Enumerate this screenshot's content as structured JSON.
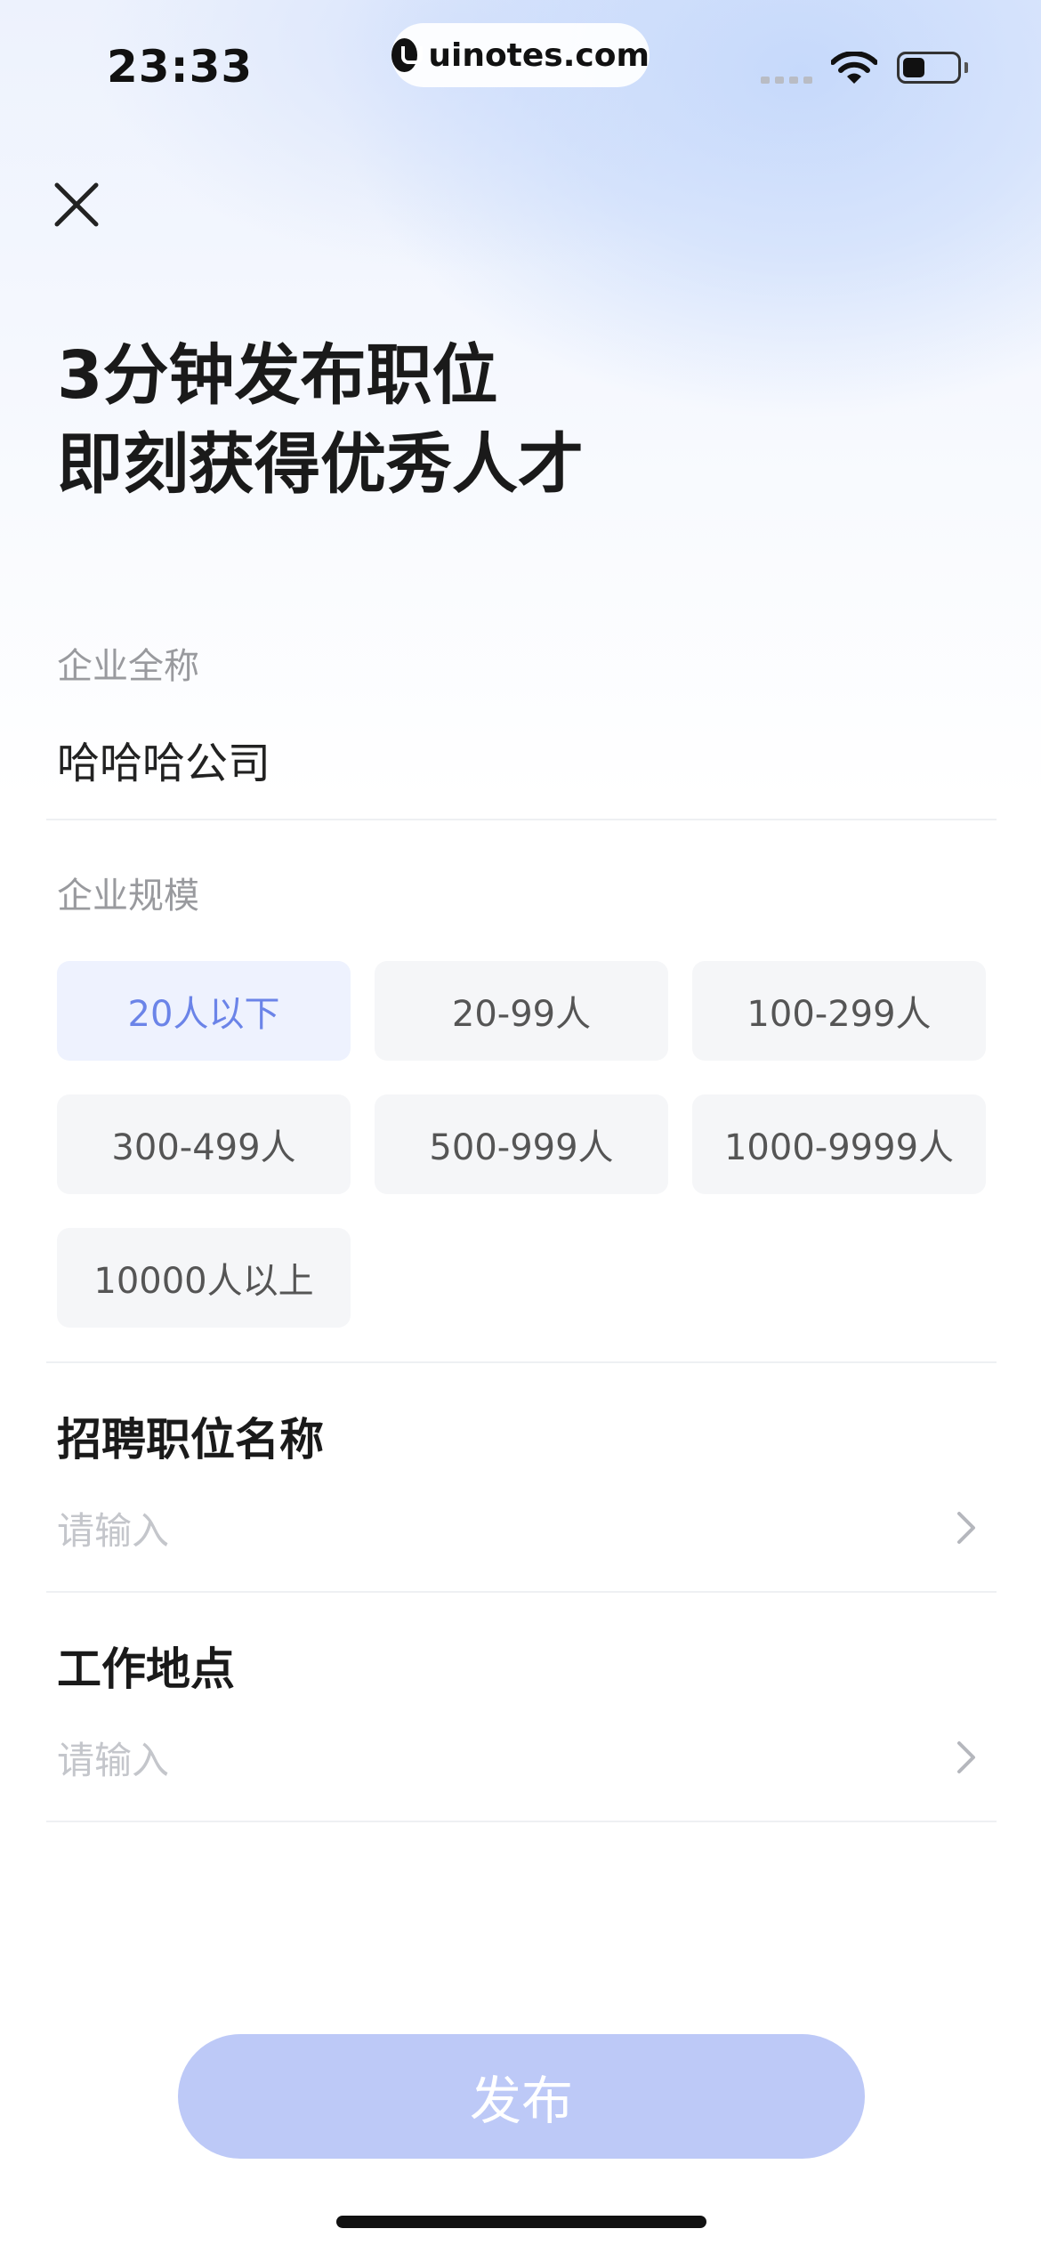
{
  "status_bar": {
    "time": "23:33",
    "url": "uinotes.com"
  },
  "header": {
    "title_line1": "3分钟发布职位",
    "title_line2": "即刻获得优秀人才"
  },
  "company_name": {
    "label": "企业全称",
    "value": "哈哈哈公司"
  },
  "company_size": {
    "label": "企业规模",
    "options": [
      "20人以下",
      "20-99人",
      "100-299人",
      "300-499人",
      "500-999人",
      "1000-9999人",
      "10000人以上"
    ],
    "selected": "20人以下"
  },
  "job_title": {
    "label": "招聘职位名称",
    "placeholder": "请输入"
  },
  "work_location": {
    "label": "工作地点",
    "placeholder": "请输入"
  },
  "publish_button": {
    "label": "发布"
  },
  "colors": {
    "accent": "#6b84e8",
    "chip_selected_bg": "#eef2fe",
    "button_bg": "#bdc9f7"
  },
  "icons": [
    "close-icon",
    "wifi-icon",
    "battery-icon",
    "chevron-right-icon"
  ]
}
